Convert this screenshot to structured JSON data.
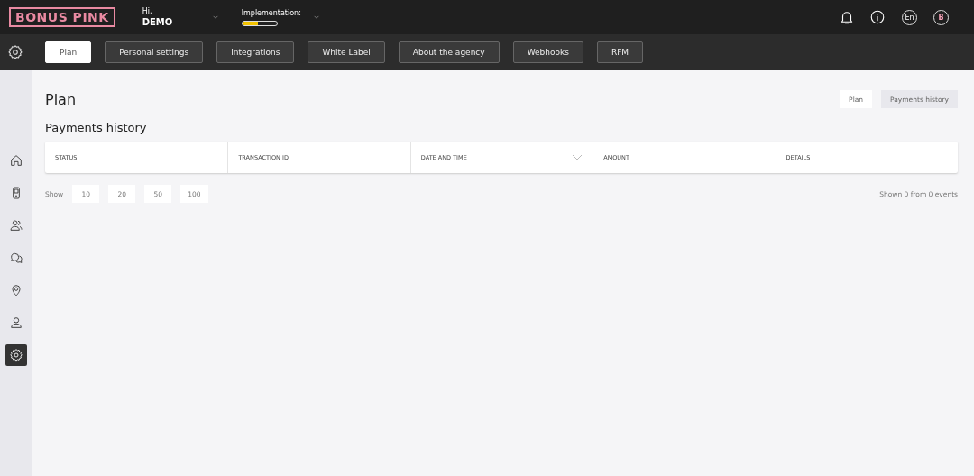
{
  "header": {
    "logo": "BONUS PINK",
    "greeting": "Hi,",
    "user": "DEMO",
    "implementation": {
      "label": "Implementation:",
      "level": 0.45
    },
    "language": "En",
    "avatar": "B"
  },
  "tabs": [
    {
      "label": "Plan",
      "selected": true
    },
    {
      "label": "Personal settings",
      "selected": false
    },
    {
      "label": "Integrations",
      "selected": false
    },
    {
      "label": "White Label",
      "selected": false
    },
    {
      "label": "About the agency",
      "selected": false
    },
    {
      "label": "Webhooks",
      "selected": false
    },
    {
      "label": "RFM",
      "selected": false
    }
  ],
  "sidebar": {
    "items": [
      {
        "kind": "home",
        "selected": false
      },
      {
        "kind": "phone",
        "selected": false
      },
      {
        "kind": "users",
        "selected": false
      },
      {
        "kind": "chat",
        "selected": false
      },
      {
        "kind": "pin",
        "selected": false
      },
      {
        "kind": "user",
        "selected": false
      },
      {
        "kind": "gear",
        "selected": true
      }
    ]
  },
  "page": {
    "title": "Plan",
    "section": "Payments history",
    "switch": [
      {
        "label": "Plan",
        "selected": false
      },
      {
        "label": "Payments history",
        "selected": true
      }
    ]
  },
  "table": {
    "columns": [
      {
        "label": "STATUS",
        "sortable": false
      },
      {
        "label": "TRANSACTION ID",
        "sortable": false
      },
      {
        "label": "DATE AND TIME",
        "sortable": true
      },
      {
        "label": "AMOUNT",
        "sortable": false
      },
      {
        "label": "DETAILS",
        "sortable": false
      }
    ]
  },
  "pager": {
    "label": "Show",
    "sizes": [
      "10",
      "20",
      "50",
      "100"
    ],
    "summary": "Shown 0 from 0 events"
  }
}
